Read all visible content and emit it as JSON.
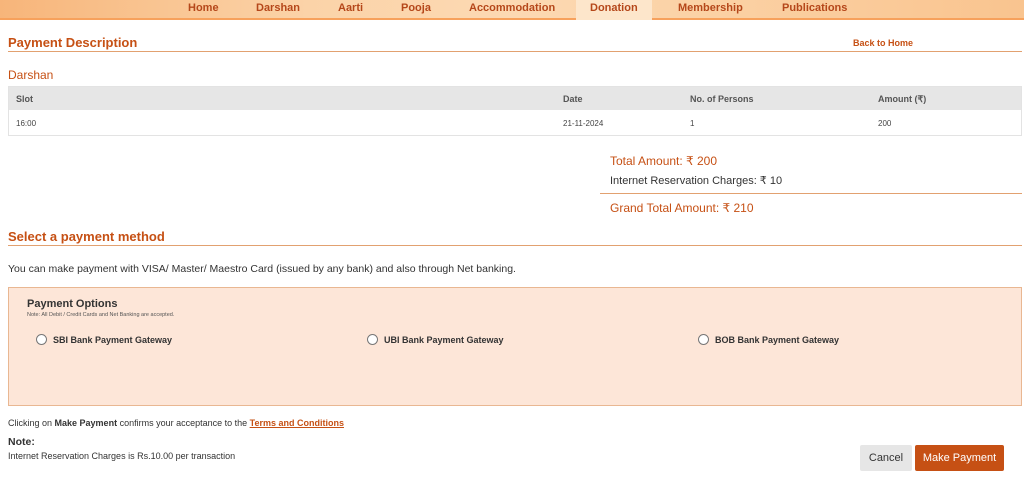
{
  "nav": {
    "items": [
      {
        "label": "Home"
      },
      {
        "label": "Darshan"
      },
      {
        "label": "Aarti"
      },
      {
        "label": "Pooja"
      },
      {
        "label": "Accommodation"
      },
      {
        "label": "Donation"
      },
      {
        "label": "Membership"
      },
      {
        "label": "Publications"
      }
    ]
  },
  "payment_description": {
    "title": "Payment Description",
    "back_link": "Back to Home"
  },
  "booking": {
    "category": "Darshan",
    "columns": [
      "Slot",
      "Date",
      "No. of Persons",
      "Amount (₹)"
    ],
    "rows": [
      {
        "slot": "16:00",
        "date": "21-11-2024",
        "persons": "1",
        "amount": "200"
      }
    ]
  },
  "summary": {
    "total": "Total Amount: ₹ 200",
    "charges": "Internet Reservation Charges: ₹ 10",
    "grand_total": "Grand Total Amount: ₹ 210"
  },
  "payment_method": {
    "title": "Select a payment method",
    "info": "You can make payment with VISA/ Master/ Maestro Card (issued by any bank) and also through Net banking.",
    "options_title": "Payment Options",
    "options_note": "Note: All Debit / Credit Cards and Net Banking are accepted.",
    "options": [
      {
        "label": "SBI Bank Payment Gateway"
      },
      {
        "label": "UBI Bank Payment Gateway"
      },
      {
        "label": "BOB Bank Payment Gateway"
      }
    ]
  },
  "terms": {
    "prefix": "Clicking on ",
    "action": "Make Payment",
    "middle": " confirms your acceptance to the ",
    "link": "Terms and Conditions"
  },
  "note": {
    "label": "Note:",
    "text": "Internet Reservation Charges is Rs.10.00 per transaction"
  },
  "buttons": {
    "cancel": "Cancel",
    "pay": "Make Payment"
  },
  "colors": {
    "accent": "#c65014",
    "panel_bg": "#fde6d8"
  }
}
